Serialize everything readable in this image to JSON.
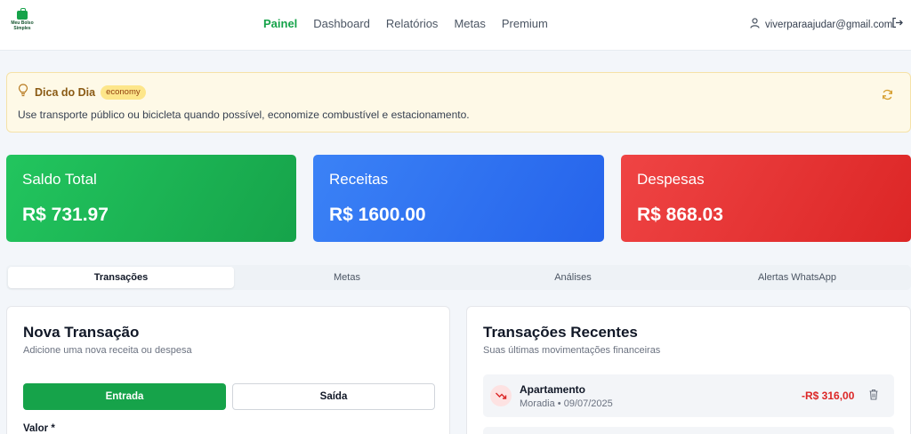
{
  "brand": {
    "logo_text_line1": "Meu Bolso",
    "logo_text_line2": "Simples"
  },
  "nav": {
    "items": [
      "Painel",
      "Dashboard",
      "Relatórios",
      "Metas",
      "Premium"
    ],
    "active": "Painel"
  },
  "user": {
    "email": "viverparaajudar@gmail.com"
  },
  "tip": {
    "title": "Dica do Dia",
    "badge": "economy",
    "text": "Use transporte público ou bicicleta quando possível, economize combustível e estacionamento."
  },
  "summary": {
    "saldo": {
      "title": "Saldo Total",
      "value": "R$ 731.97",
      "color": "#16a34a"
    },
    "receitas": {
      "title": "Receitas",
      "value": "R$ 1600.00",
      "color": "#2563eb"
    },
    "despesas": {
      "title": "Despesas",
      "value": "R$ 868.03",
      "color": "#dc2626"
    }
  },
  "tabs": [
    "Transações",
    "Metas",
    "Análises",
    "Alertas WhatsApp"
  ],
  "new_transaction": {
    "title": "Nova Transação",
    "subtitle": "Adicione uma nova receita ou despesa",
    "btn_in": "Entrada",
    "btn_out": "Saída",
    "value_label": "Valor *"
  },
  "recent": {
    "title": "Transações Recentes",
    "subtitle": "Suas últimas movimentações financeiras",
    "items": [
      {
        "name": "Apartamento",
        "category": "Moradia",
        "date": "09/07/2025",
        "amount": "-R$ 316,00"
      }
    ]
  },
  "colors": {
    "accent": "#16a34a",
    "danger": "#dc2626",
    "tip_bg": "#fef9e7"
  }
}
